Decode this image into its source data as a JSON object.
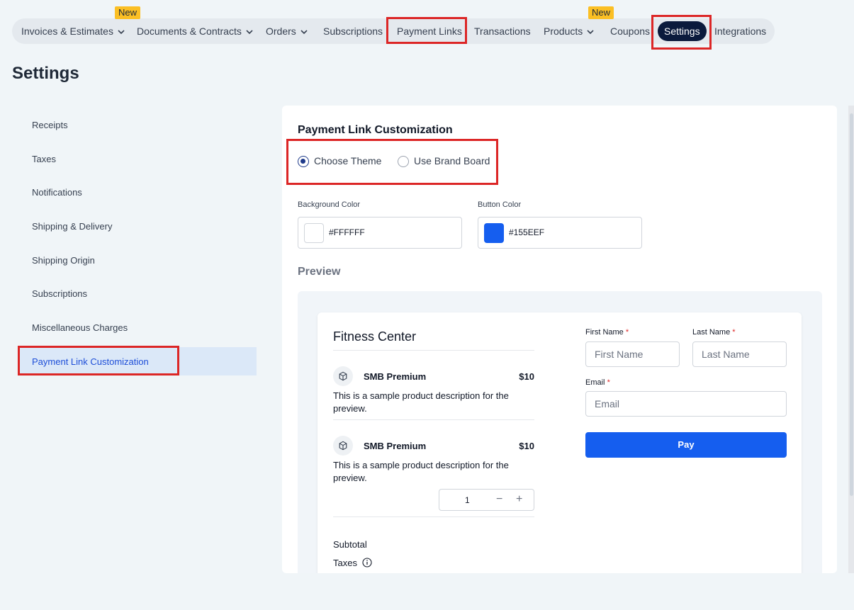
{
  "nav": {
    "items": [
      {
        "label": "Invoices & Estimates",
        "has_dropdown": true
      },
      {
        "label": "Documents & Contracts",
        "has_dropdown": true
      },
      {
        "label": "Orders",
        "has_dropdown": true
      },
      {
        "label": "Subscriptions",
        "has_dropdown": false
      },
      {
        "label": "Payment Links",
        "has_dropdown": false
      },
      {
        "label": "Transactions",
        "has_dropdown": false
      },
      {
        "label": "Products",
        "has_dropdown": true
      },
      {
        "label": "Coupons",
        "has_dropdown": false
      },
      {
        "label": "Settings",
        "has_dropdown": false,
        "active": true
      },
      {
        "label": "Integrations",
        "has_dropdown": false
      }
    ],
    "badges": {
      "invoices": "New",
      "coupons": "New"
    }
  },
  "page": {
    "title": "Settings"
  },
  "sidebar": {
    "items": [
      {
        "label": "Receipts"
      },
      {
        "label": "Taxes"
      },
      {
        "label": "Notifications"
      },
      {
        "label": "Shipping & Delivery"
      },
      {
        "label": "Shipping Origin"
      },
      {
        "label": "Subscriptions"
      },
      {
        "label": "Miscellaneous Charges"
      },
      {
        "label": "Payment Link Customization",
        "active": true
      }
    ]
  },
  "customization": {
    "title": "Payment Link Customization",
    "options": [
      {
        "label": "Choose Theme",
        "checked": true
      },
      {
        "label": "Use Brand Board",
        "checked": false
      }
    ],
    "background_color": {
      "label": "Background Color",
      "value": "#FFFFFF"
    },
    "button_color": {
      "label": "Button Color",
      "value": "#155EEF"
    },
    "preview_label": "Preview"
  },
  "preview": {
    "business_name": "Fitness Center",
    "products": [
      {
        "name": "SMB Premium",
        "price": "$10",
        "description": "This is a sample product description for the preview.",
        "icon": "box-icon"
      },
      {
        "name": "SMB Premium",
        "price": "$10",
        "description": "This is a sample product description for the preview.",
        "icon": "box-icon"
      }
    ],
    "quantity": "1",
    "subtotal_label": "Subtotal",
    "taxes_label": "Taxes",
    "form": {
      "first_name_label": "First Name",
      "first_name_placeholder": "First Name",
      "last_name_label": "Last Name",
      "last_name_placeholder": "Last Name",
      "email_label": "Email",
      "email_placeholder": "Email",
      "required_mark": "*",
      "pay_label": "Pay"
    }
  },
  "colors": {
    "nav_active_bg": "#0b1a3c",
    "badge": "#fbbf24",
    "accent": "#155eef",
    "highlight": "#dc2626",
    "sidebar_active_bg": "#dbe8f8"
  }
}
